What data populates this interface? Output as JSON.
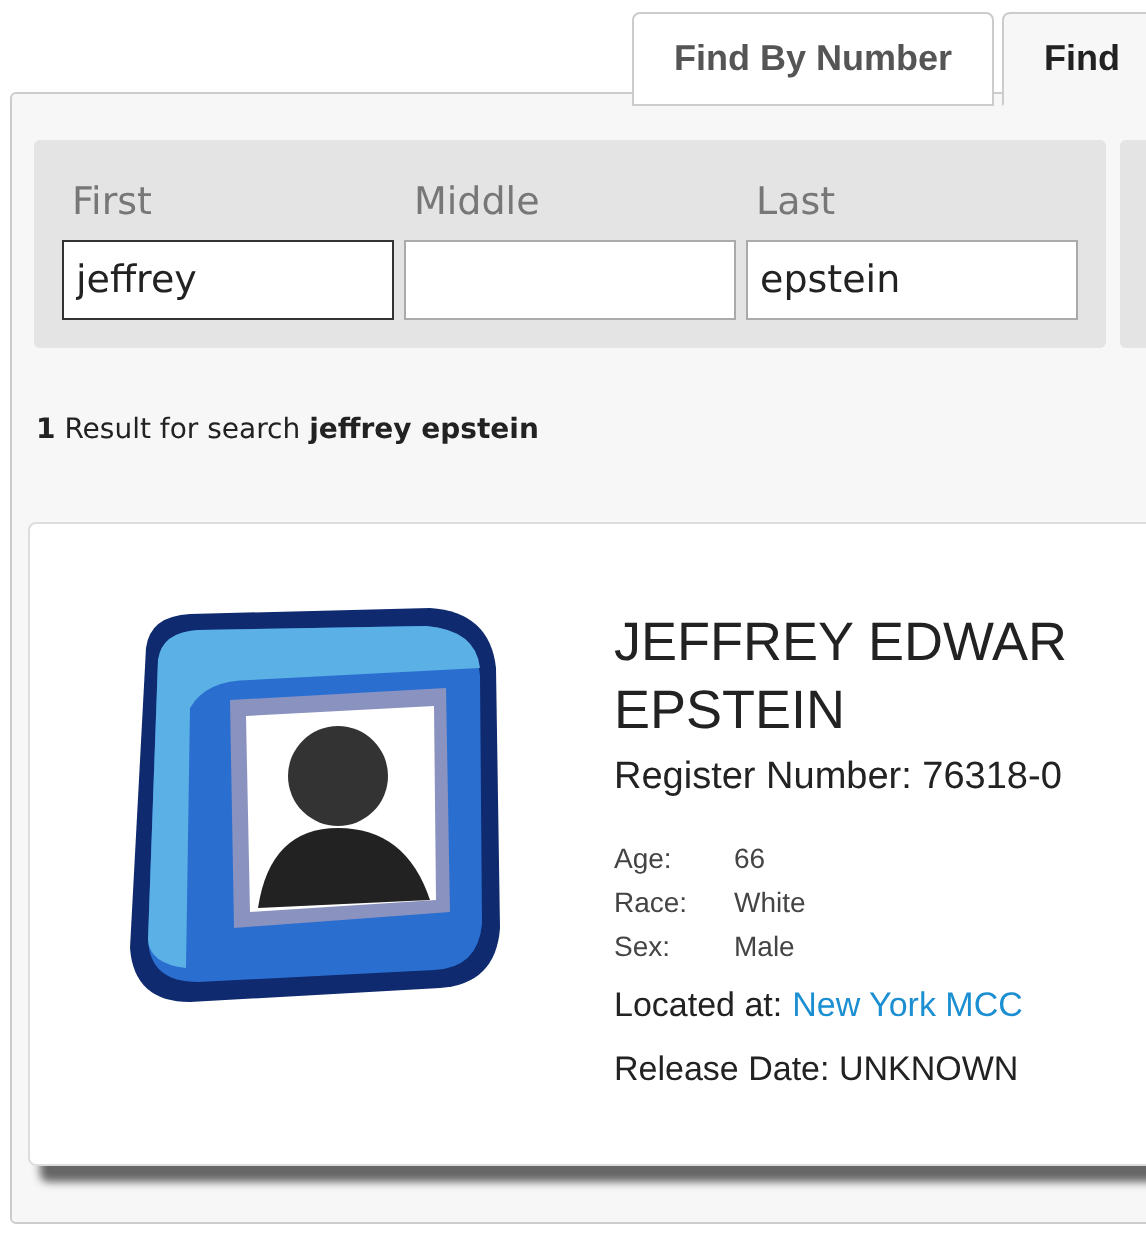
{
  "tabs": [
    {
      "label": "Find By Number",
      "selected": false
    },
    {
      "label": "Find",
      "selected": true
    }
  ],
  "search": {
    "fields": [
      {
        "label": "First",
        "value": "jeffrey",
        "focused": true
      },
      {
        "label": "Middle",
        "focused": false
      },
      {
        "label": "Last",
        "value": "epstein",
        "focused": false
      }
    ]
  },
  "result_summary": "**1** Result for search **jeffrey epstein**",
  "result": {
    "name": "JEFFREY EDWAR EPSTEIN",
    "register_number": "Register Number: 76318-0",
    "details": [
      {
        "label": "Age:",
        "value": "66"
      },
      {
        "label": "Race:",
        "value": "White"
      },
      {
        "label": "Sex:",
        "value": "Male"
      }
    ],
    "location_label": "Located at:",
    "location": "New York MCC",
    "release_date": "Release Date: UNKNOWN"
  }
}
